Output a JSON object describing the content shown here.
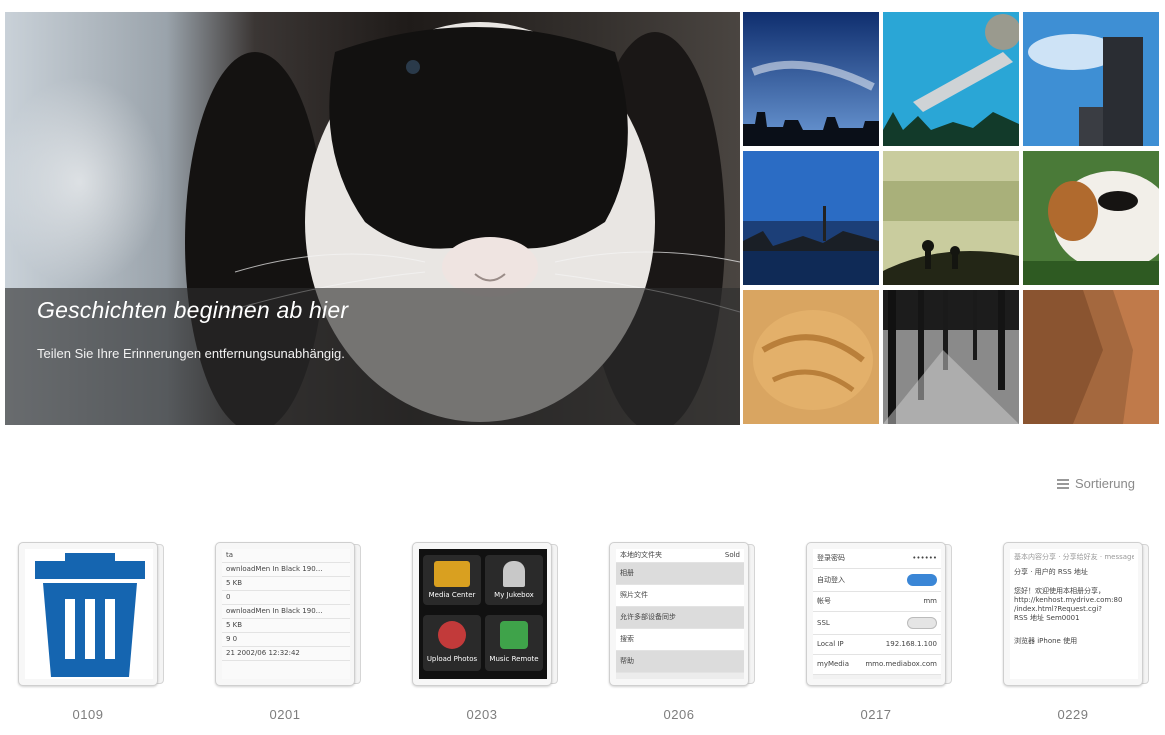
{
  "hero": {
    "title": "Geschichten beginnen ab hier",
    "subtitle": "Teilen Sie Ihre Erinnerungen entfernungsunabhängig."
  },
  "grid": {
    "photos": [
      {
        "name": "sky-city-silhouette"
      },
      {
        "name": "ufo-over-trees"
      },
      {
        "name": "tower-blue-sky"
      },
      {
        "name": "harbor-boats"
      },
      {
        "name": "misty-field-figures"
      },
      {
        "name": "guinea-pig"
      },
      {
        "name": "sleeping-cat"
      },
      {
        "name": "tree-avenue"
      },
      {
        "name": "rock-cliff"
      }
    ]
  },
  "sort": {
    "label": "Sortierung",
    "icon": "list-icon"
  },
  "albums": [
    {
      "label": "0109"
    },
    {
      "label": "0201"
    },
    {
      "label": "0203"
    },
    {
      "label": "0206"
    },
    {
      "label": "0217"
    },
    {
      "label": "0229"
    }
  ],
  "covers": {
    "downloads": {
      "rows": [
        "ta",
        "ownloadMen In Black 190…",
        "5 KB",
        "0",
        "ownloadMen In Black 190…",
        "5 KB",
        "9 0",
        "21 2002/06 12:32:42"
      ]
    },
    "media": {
      "tiles": [
        "Media Center",
        "My Jukebox",
        "Upload Photos",
        "Music Remote"
      ]
    },
    "settings": {
      "rows": [
        "本地的文件夹",
        "相册",
        "照片文件",
        "允许多部设备同步",
        "搜索",
        "帮助"
      ],
      "top_right": "Sold"
    },
    "network": {
      "rows": [
        "登录密码",
        "自动登入",
        "帐号",
        "SSL",
        "Local IP",
        "myMedia"
      ],
      "values": [
        "••••••",
        "",
        "mm",
        "",
        "192.168.1.100",
        "mmo.mediabox.com"
      ]
    },
    "share": {
      "lines": [
        "基本内容分享 · 分享给好友 · message",
        "分享 · 用户的 RSS 地址",
        "您好！欢迎使用本相册分享，",
        "http://kenhost.mydrive.com:80",
        "/index.html?Request.cgi?",
        "RSS 地址 Sem0001",
        "",
        "浏览器 iPhone 使用"
      ]
    }
  }
}
